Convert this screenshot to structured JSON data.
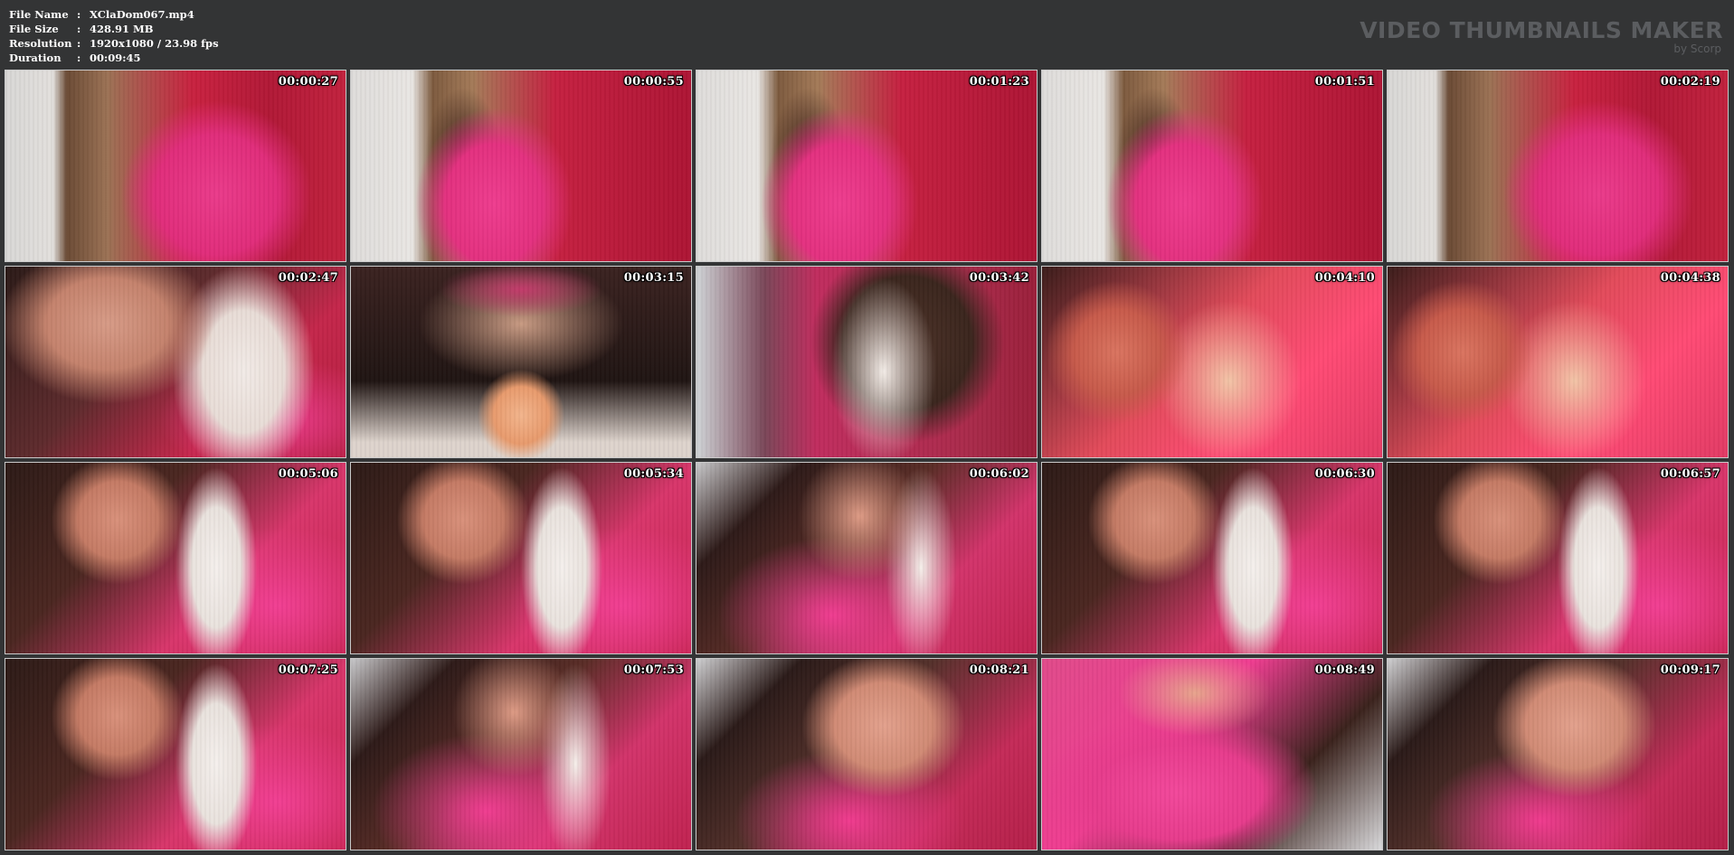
{
  "info": {
    "rows": [
      {
        "label": "File Name",
        "sep": ":",
        "value": "XClaDom067.mp4"
      },
      {
        "label": "File Size",
        "sep": ":",
        "value": "428.91 MB"
      },
      {
        "label": "Resolution",
        "sep": ":",
        "value": "1920x1080 / 23.98 fps"
      },
      {
        "label": "Duration",
        "sep": ":",
        "value": "00:09:45"
      }
    ]
  },
  "brand": {
    "title": "VIDEO THUMBNAILS MAKER",
    "subtitle": "by Scorp"
  },
  "thumbnails": [
    {
      "time": "00:00:27",
      "scene": "s-room"
    },
    {
      "time": "00:00:55",
      "scene": "s-room2"
    },
    {
      "time": "00:01:23",
      "scene": "s-room2"
    },
    {
      "time": "00:01:51",
      "scene": "s-room2"
    },
    {
      "time": "00:02:19",
      "scene": "s-room"
    },
    {
      "time": "00:02:47",
      "scene": "s-face"
    },
    {
      "time": "00:03:15",
      "scene": "s-mouth"
    },
    {
      "time": "00:03:42",
      "scene": "s-bend"
    },
    {
      "time": "00:04:10",
      "scene": "s-red"
    },
    {
      "time": "00:04:38",
      "scene": "s-red"
    },
    {
      "time": "00:05:06",
      "scene": "s-pink"
    },
    {
      "time": "00:05:34",
      "scene": "s-pink"
    },
    {
      "time": "00:06:02",
      "scene": "s-pink2"
    },
    {
      "time": "00:06:30",
      "scene": "s-pink"
    },
    {
      "time": "00:06:57",
      "scene": "s-pink"
    },
    {
      "time": "00:07:25",
      "scene": "s-pink"
    },
    {
      "time": "00:07:53",
      "scene": "s-pink2"
    },
    {
      "time": "00:08:21",
      "scene": "s-closeup"
    },
    {
      "time": "00:08:49",
      "scene": "s-drool"
    },
    {
      "time": "00:09:17",
      "scene": "s-closeup"
    }
  ]
}
